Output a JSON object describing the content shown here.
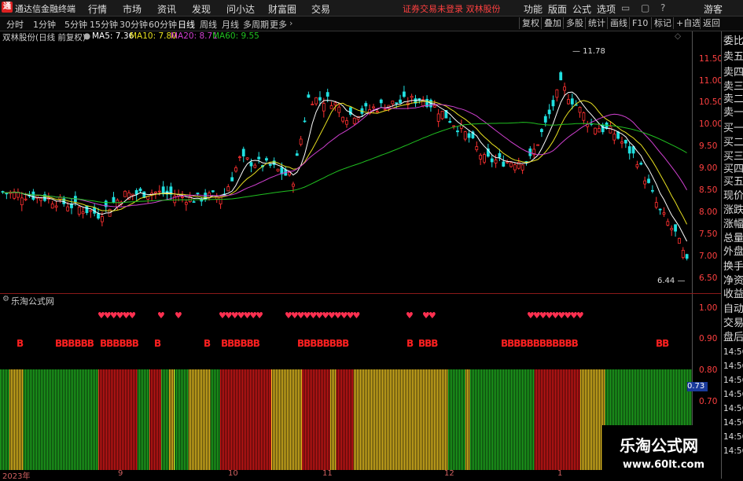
{
  "app": {
    "name": "通达信金融终端",
    "logo": "通"
  },
  "menu": {
    "items": [
      "行情",
      "市场",
      "资讯",
      "发现",
      "问小达",
      "财富圈",
      "交易"
    ],
    "notice": "证券交易未登录 双林股份",
    "right_items": [
      "功能",
      "版面",
      "公式",
      "选项"
    ],
    "user": "游客"
  },
  "tabs": [
    "分时",
    "1分钟",
    "5分钟",
    "15分钟",
    "30分钟",
    "60分钟",
    "日线",
    "周线",
    "月线",
    "多周期",
    "更多"
  ],
  "active_tab": "日线",
  "toolbar_right": [
    "复权",
    "叠加",
    "多股",
    "统计",
    "画线",
    "F10",
    "标记",
    "+自选",
    "返回"
  ],
  "info": {
    "stock": "双林股份(日线 前复权)",
    "ma5": "MA5: 7.36",
    "ma10": "MA10: 7.80",
    "ma20": "MA20: 8.71",
    "ma60": "MA60: 9.55"
  },
  "colors": {
    "ma5": "#ffffff",
    "ma10": "#e8e020",
    "ma20": "#d040d0",
    "ma60": "#20c020",
    "up": "#ff3030",
    "down": "#20e0e0"
  },
  "y_axis": [
    "11.50",
    "11.00",
    "10.50",
    "10.00",
    "9.50",
    "9.00",
    "8.50",
    "8.00",
    "7.50",
    "7.00",
    "6.50"
  ],
  "price_high": "11.78",
  "price_low": "6.44",
  "right_panel": [
    "委比",
    "卖五",
    "卖四",
    "卖三",
    "卖二",
    "卖一",
    "买一",
    "买二",
    "买三",
    "买四",
    "买五",
    "现价",
    "涨跌",
    "涨幅",
    "总量",
    "外盘",
    "换手",
    "净资",
    "收益",
    "自动",
    "交易",
    "盘后"
  ],
  "right_times": [
    "14:56",
    "14:56",
    "14:56",
    "14:56",
    "14:56",
    "14:56",
    "14:56",
    "14:56"
  ],
  "sub": {
    "title": "乐淘公式网",
    "y_axis": [
      "1.00",
      "0.90",
      "0.80",
      "0.70"
    ],
    "current": "0.73"
  },
  "signals": [
    {
      "text": "B"
    },
    {
      "text": "BBBBBB"
    },
    {
      "text": "BBBBBB"
    },
    {
      "text": "B"
    },
    {
      "text": "B"
    },
    {
      "text": "BBBBBB"
    },
    {
      "text": "BBBBBB"
    },
    {
      "text": "BB"
    },
    {
      "text": "B"
    },
    {
      "text": "BBB"
    },
    {
      "text": "BBBBBBBBBBBB"
    },
    {
      "text": "BB"
    }
  ],
  "gems": [
    {
      "text": "♥♥♥♥♥♥"
    },
    {
      "text": "♥"
    },
    {
      "text": "♥"
    },
    {
      "text": "♥♥♥♥♥♥♥"
    },
    {
      "text": "♥♥♥♥♥♥♥♥♥♥♥♥"
    },
    {
      "text": "♥"
    },
    {
      "text": "♥♥"
    },
    {
      "text": "♥♥♥♥♥♥♥♥♥"
    }
  ],
  "x_axis": [
    "2023年",
    "9",
    "10",
    "11",
    "12",
    "1"
  ],
  "watermark": {
    "title": "乐淘公式网",
    "url": "www.60lt.com"
  }
}
